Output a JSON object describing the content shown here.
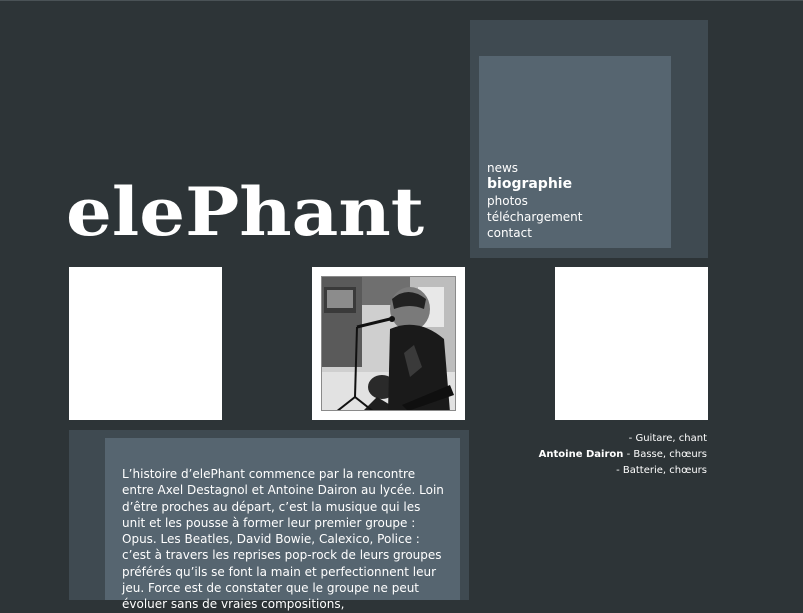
{
  "nav": {
    "items": [
      "news",
      "biographie",
      "photos",
      "téléchargement",
      "contact"
    ],
    "active": "biographie"
  },
  "logo": {
    "text": "elePhant"
  },
  "members": [
    {
      "name": "",
      "role": "- Guitare, chant"
    },
    {
      "name": "Antoine Dairon",
      "role": " - Basse, chœurs"
    },
    {
      "name": "",
      "role": "- Batterie, chœurs"
    }
  ],
  "bio": {
    "text": "L’histoire d’elePhant commence par la rencontre entre Axel Destagnol et Antoine Dairon au lycée. Loin d’être proches au départ, c’est la musique qui les unit et les pousse à former leur premier groupe : Opus. Les Beatles, David Bowie, Calexico, Police : c’est à travers les reprises pop-rock de leurs groupes préférés qu’ils se font la main et perfectionnent leur jeu. Force est de constater que le groupe ne peut évoluer sans de vraies compositions,"
  },
  "colors": {
    "background": "#2d3437",
    "panel_outer": "#3f4a51",
    "panel_inner": "#566570",
    "text": "#ffffff"
  }
}
